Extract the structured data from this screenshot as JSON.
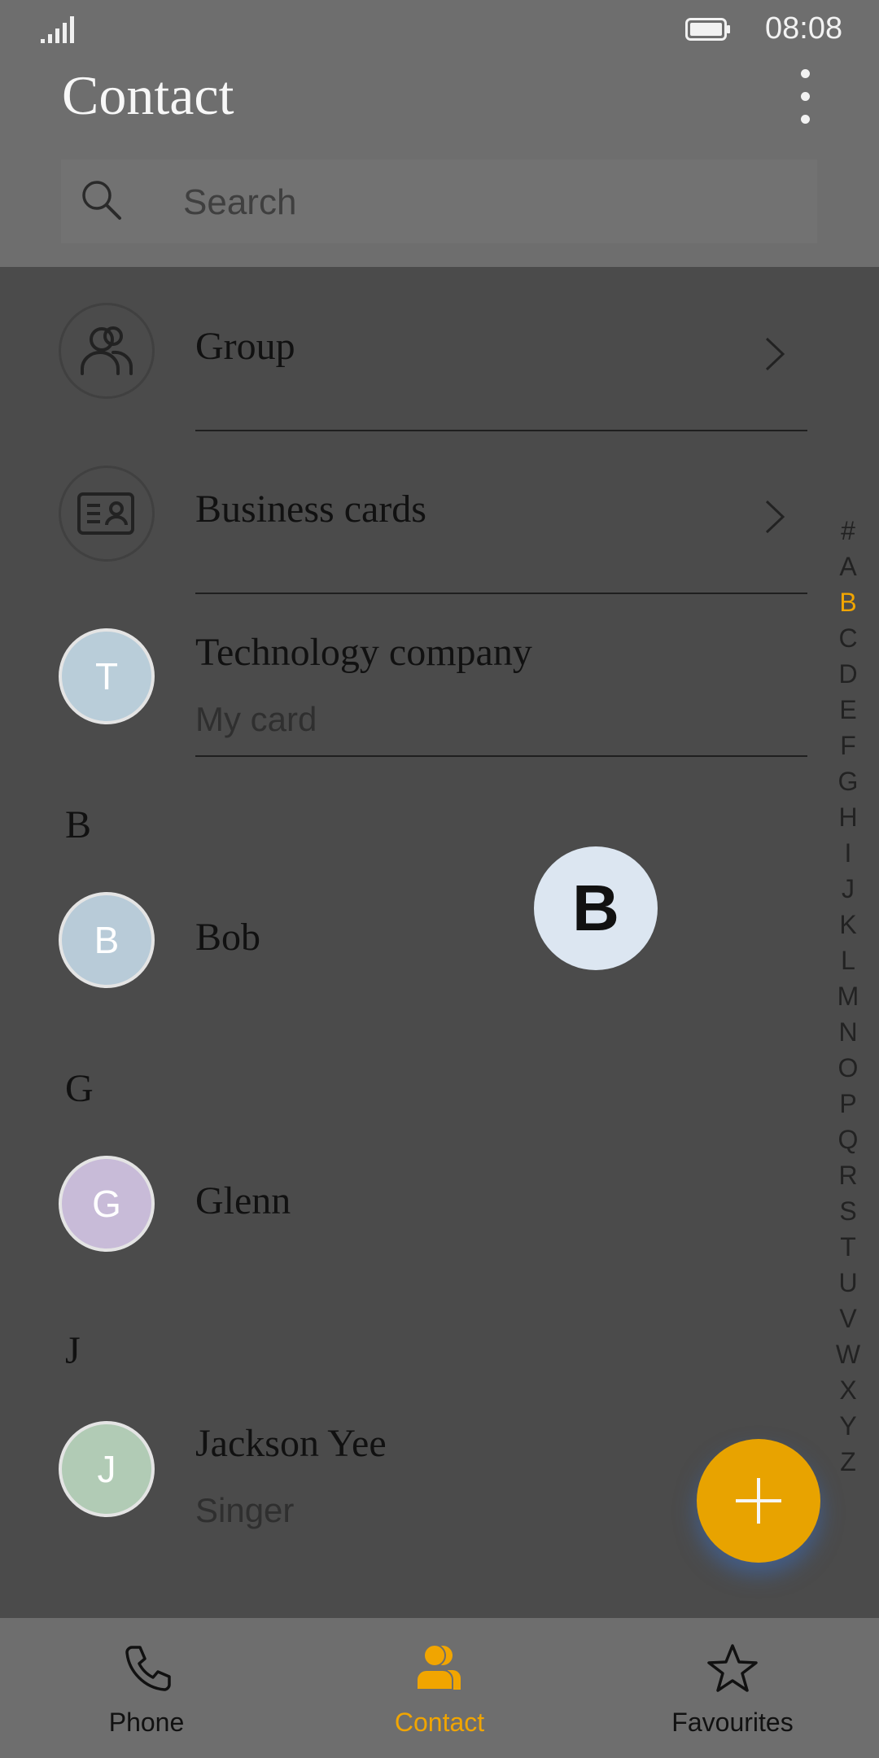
{
  "status_bar": {
    "time": "08:08"
  },
  "header": {
    "title": "Contact"
  },
  "search": {
    "placeholder": "Search"
  },
  "list": {
    "group_label": "Group",
    "business_cards_label": "Business cards",
    "my_card": {
      "initial": "T",
      "name": "Technology company",
      "subtitle": "My card",
      "color": "#b9cdd9"
    },
    "sections": [
      {
        "letter": "B",
        "contacts": [
          {
            "initial": "B",
            "name": "Bob",
            "subtitle": "",
            "color": "#b8cbd8"
          }
        ]
      },
      {
        "letter": "G",
        "contacts": [
          {
            "initial": "G",
            "name": "Glenn",
            "subtitle": "",
            "color": "#c8bbd8"
          }
        ]
      },
      {
        "letter": "J",
        "contacts": [
          {
            "initial": "J",
            "name": "Jackson Yee",
            "subtitle": "Singer",
            "color": "#b1cbb5"
          }
        ]
      }
    ]
  },
  "alpha_index": [
    "#",
    "A",
    "B",
    "C",
    "D",
    "E",
    "F",
    "G",
    "H",
    "I",
    "J",
    "K",
    "L",
    "M",
    "N",
    "O",
    "P",
    "Q",
    "R",
    "S",
    "T",
    "U",
    "V",
    "W",
    "X",
    "Y",
    "Z"
  ],
  "alpha_index_active": "B",
  "letter_bubble": "B",
  "bottom_nav": {
    "items": [
      {
        "label": "Phone",
        "icon": "phone-icon",
        "active": false
      },
      {
        "label": "Contact",
        "icon": "contacts-icon",
        "active": true
      },
      {
        "label": "Favourites",
        "icon": "star-icon",
        "active": false
      }
    ]
  },
  "colors": {
    "accent": "#f1a500",
    "fab": "#e8a300"
  }
}
